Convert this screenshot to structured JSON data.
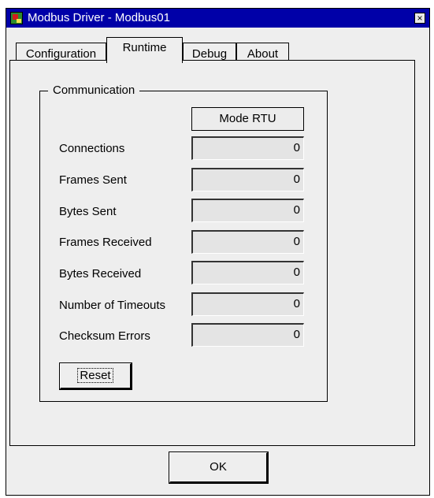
{
  "window": {
    "title": "Modbus Driver - Modbus01",
    "close_label": "×"
  },
  "tabs": [
    {
      "label": "Configuration",
      "active": false
    },
    {
      "label": "Runtime",
      "active": true
    },
    {
      "label": "Debug",
      "active": false
    },
    {
      "label": "About",
      "active": false
    }
  ],
  "communication": {
    "legend": "Communication",
    "mode": "Mode RTU",
    "stats": [
      {
        "label": "Connections",
        "value": "0"
      },
      {
        "label": "Frames Sent",
        "value": "0"
      },
      {
        "label": "Bytes Sent",
        "value": "0"
      },
      {
        "label": "Frames Received",
        "value": "0"
      },
      {
        "label": "Bytes Received",
        "value": "0"
      },
      {
        "label": "Number of Timeouts",
        "value": "0"
      },
      {
        "label": "Checksum Errors",
        "value": "0"
      }
    ],
    "reset_label": "Reset"
  },
  "ok_label": "OK",
  "colors": {
    "titlebar": "#0000a8",
    "dialog_bg": "#eeeeee"
  }
}
